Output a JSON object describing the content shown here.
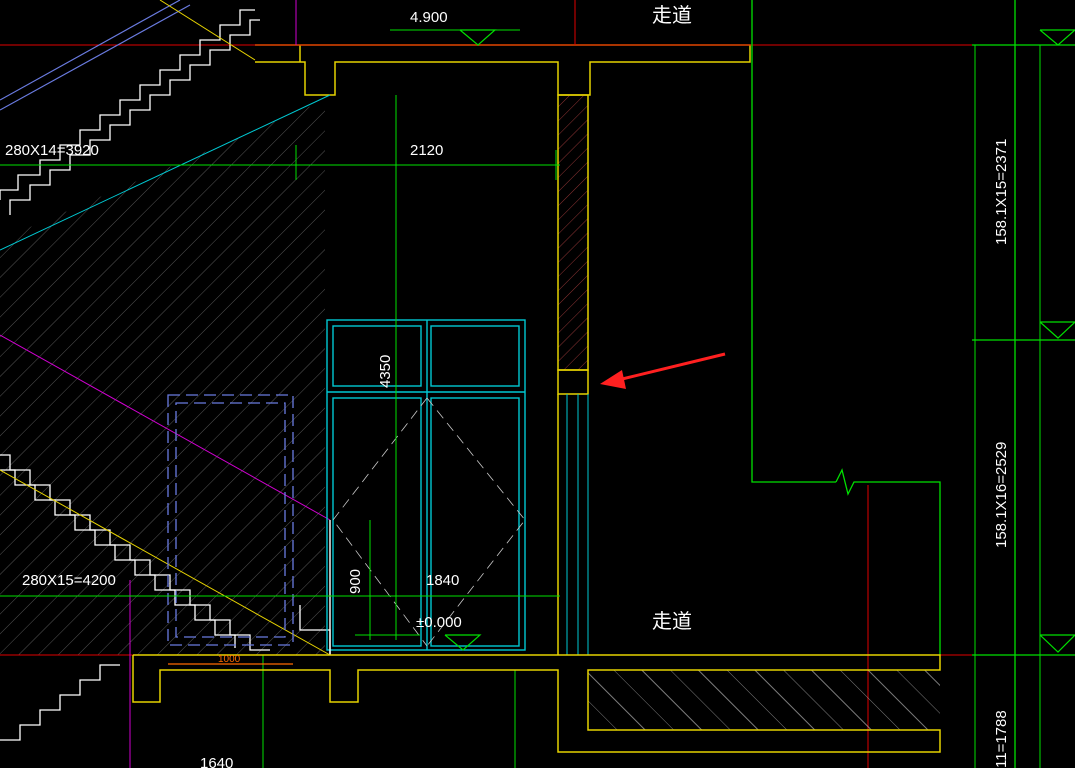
{
  "colors": {
    "background": "#000000",
    "wall": "#e6d200",
    "dimension": "#00e000",
    "door": "#00c8d2",
    "axis": "#e00000",
    "magenta": "#d000d0",
    "blue_dash": "#6a7be0",
    "white": "#ffffff",
    "arrow": "#ff2020",
    "hatch": "#c8c8c8",
    "orange": "#ff6a00"
  },
  "labels": {
    "level_top": "4.900",
    "corridor_top": "走道",
    "corridor_bottom": "走道",
    "stair_upper": "280X14=3920",
    "stair_lower": "280X15=4200",
    "width_2120": "2120",
    "height_4350": "4350",
    "height_900": "900",
    "width_1840": "1840",
    "level_zero": "±0.000",
    "riser_upper": "158.1X15=2371",
    "riser_middle": "158.1X16=2529",
    "riser_bottom": "11=1788",
    "width_1000": "1000",
    "bottom_partial": "1640"
  },
  "icons": {
    "annotation_arrow": "red-arrow-icon",
    "level_marker": "level-triangle-icon",
    "break_symbol": "break-line-icon"
  }
}
